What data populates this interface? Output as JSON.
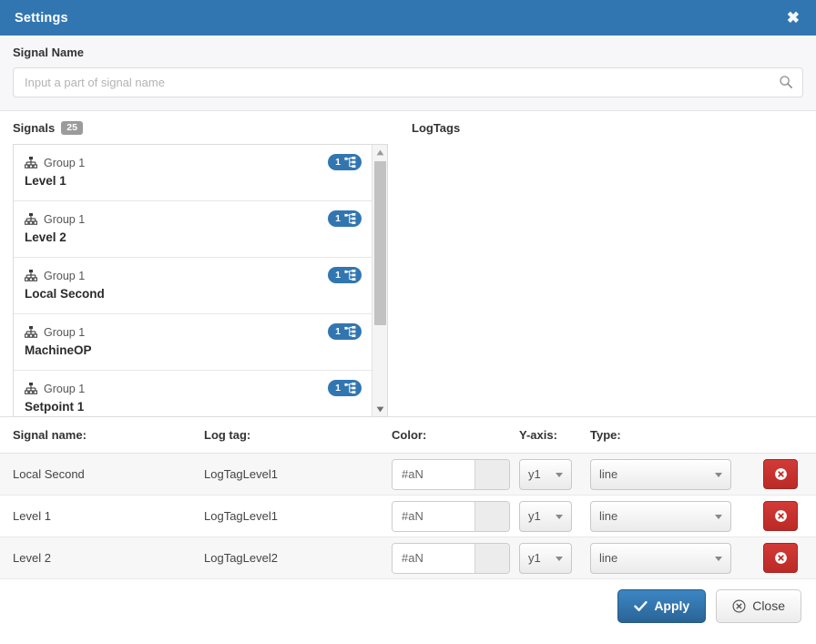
{
  "window": {
    "title": "Settings",
    "close_icon": "close-x-icon"
  },
  "search": {
    "label": "Signal Name",
    "placeholder": "Input a part of signal name",
    "value": "",
    "icon": "search-icon"
  },
  "signals_pane": {
    "heading": "Signals",
    "count": "25",
    "items": [
      {
        "group": "Group 1",
        "name": "Level 1",
        "badge_count": "1",
        "badge_icon": "sitemap-icon",
        "group_icon": "sitemap-icon"
      },
      {
        "group": "Group 1",
        "name": "Level 2",
        "badge_count": "1",
        "badge_icon": "sitemap-icon",
        "group_icon": "sitemap-icon"
      },
      {
        "group": "Group 1",
        "name": "Local Second",
        "badge_count": "1",
        "badge_icon": "sitemap-icon",
        "group_icon": "sitemap-icon"
      },
      {
        "group": "Group 1",
        "name": "MachineOP",
        "badge_count": "1",
        "badge_icon": "sitemap-icon",
        "group_icon": "sitemap-icon"
      },
      {
        "group": "Group 1",
        "name": "Setpoint 1",
        "badge_count": "1",
        "badge_icon": "sitemap-icon",
        "group_icon": "sitemap-icon"
      }
    ]
  },
  "logtags_pane": {
    "heading": "LogTags",
    "items": []
  },
  "table": {
    "headers": {
      "signal_name": "Signal name:",
      "log_tag": "Log tag:",
      "color": "Color:",
      "y_axis": "Y-axis:",
      "type": "Type:"
    },
    "rows": [
      {
        "signal_name": "Local Second",
        "log_tag": "LogTagLevel1",
        "color": "#aN",
        "y_axis": "y1",
        "type": "line",
        "delete_icon": "remove-circle-icon"
      },
      {
        "signal_name": "Level 1",
        "log_tag": "LogTagLevel1",
        "color": "#aN",
        "y_axis": "y1",
        "type": "line",
        "delete_icon": "remove-circle-icon"
      },
      {
        "signal_name": "Level 2",
        "log_tag": "LogTagLevel2",
        "color": "#aN",
        "y_axis": "y1",
        "type": "line",
        "delete_icon": "remove-circle-icon"
      }
    ]
  },
  "footer": {
    "apply_label": "Apply",
    "apply_icon": "check-icon",
    "close_label": "Close",
    "close_icon": "remove-circle-icon"
  },
  "colors": {
    "header_blue": "#3276b1",
    "badge_grey": "#9b9b9b",
    "danger_red": "#bb2a26",
    "row_stripe": "#f7f7f7"
  }
}
